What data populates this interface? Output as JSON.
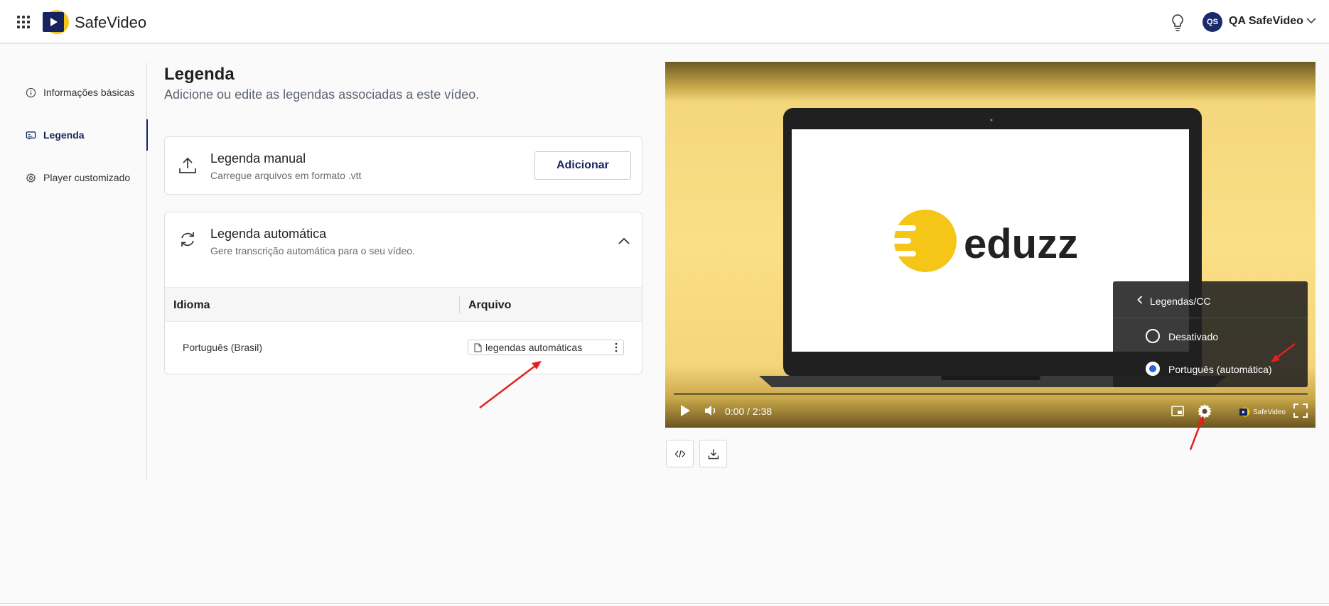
{
  "header": {
    "brand": "SafeVideo",
    "avatar_initials": "QS",
    "user_name": "QA SafeVideo",
    "brand_color": "#16245e",
    "logo_accent": "#f5c518"
  },
  "sidebar": {
    "items": [
      {
        "label": "Informações básicas",
        "icon": "info-icon",
        "active": false
      },
      {
        "label": "Legenda",
        "icon": "subtitles-icon",
        "active": true
      },
      {
        "label": "Player customizado",
        "icon": "gear-icon",
        "active": false
      }
    ]
  },
  "main": {
    "title": "Legenda",
    "subtitle": "Adicione ou edite as legendas associadas a este vídeo.",
    "manual": {
      "title": "Legenda manual",
      "description": "Carregue arquivos em formato .vtt",
      "button": "Adicionar"
    },
    "auto": {
      "title": "Legenda automática",
      "description": "Gere transcrição automática para o seu vídeo.",
      "columns": [
        "Idioma",
        "Arquivo"
      ],
      "rows": [
        {
          "language": "Português (Brasil)",
          "file": "legendas automáticas"
        }
      ]
    }
  },
  "player": {
    "video_logo_text": "eduzz",
    "time": "0:00 / 2:38",
    "brand": "SafeVideo",
    "cc_menu": {
      "title": "Legendas/CC",
      "options": [
        {
          "label": "Desativado",
          "selected": false
        },
        {
          "label": "Português (automática)",
          "selected": true
        }
      ]
    }
  }
}
